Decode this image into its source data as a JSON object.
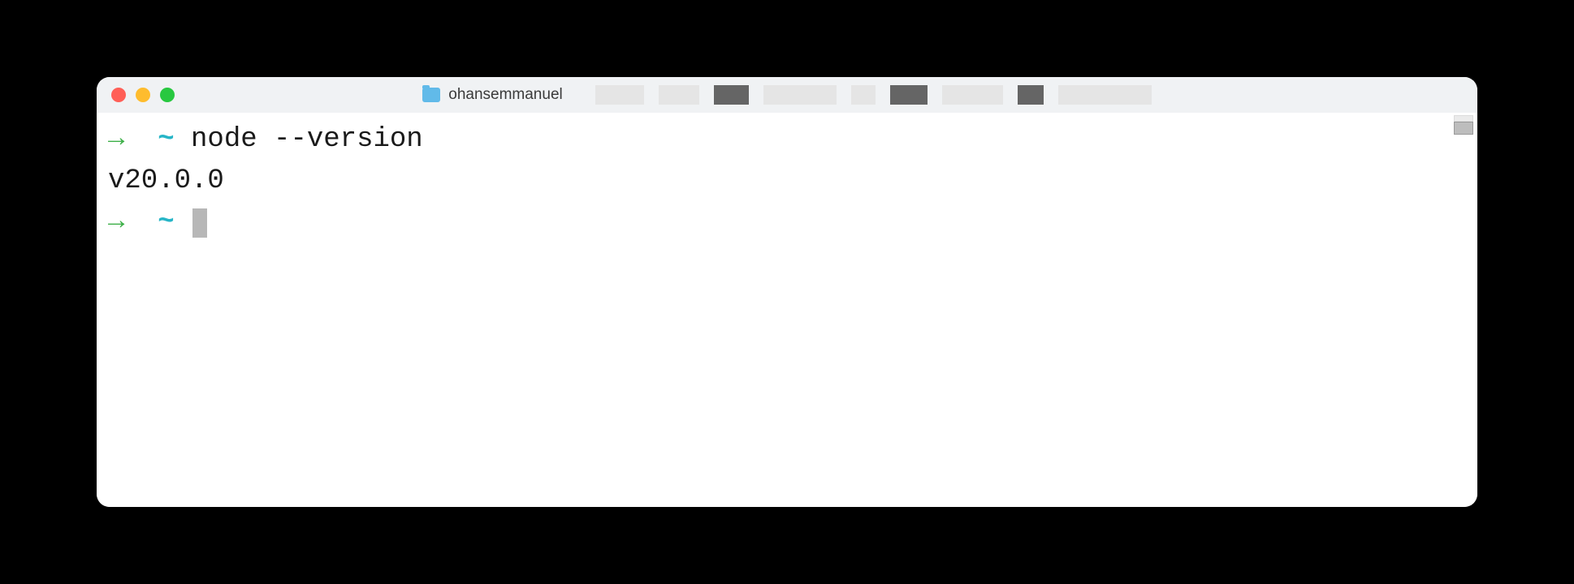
{
  "window": {
    "title": "ohansemmanuel"
  },
  "terminal": {
    "prompt_arrow": "→",
    "prompt_tilde": "~",
    "lines": [
      {
        "command": "node --version"
      },
      {
        "output": "v20.0.0"
      }
    ]
  }
}
